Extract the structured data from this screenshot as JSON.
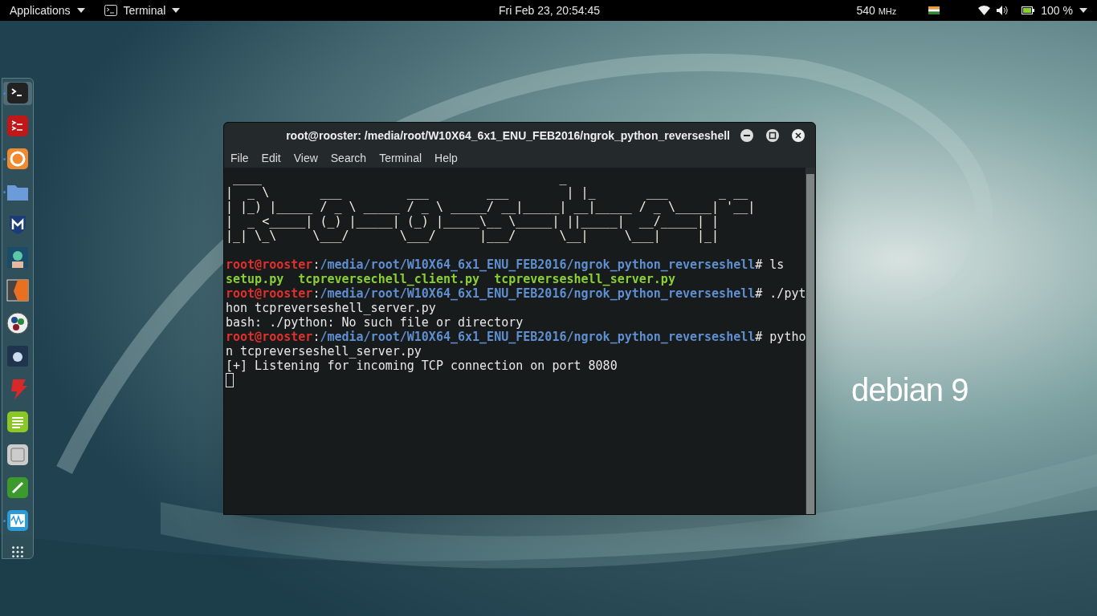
{
  "top_bar": {
    "applications_menu": "Applications",
    "app_menu": "Terminal",
    "clock": "Fri Feb 23, 20:54:45",
    "cpu_freq": "540",
    "cpu_unit": "MHz",
    "battery": "100 %"
  },
  "dock": {
    "items": [
      {
        "selected": true,
        "running": true
      },
      {
        "selected": false,
        "running": false
      },
      {
        "selected": false,
        "running": true
      },
      {
        "selected": false,
        "running": true
      },
      {
        "selected": false,
        "running": false
      },
      {
        "selected": false,
        "running": false
      },
      {
        "selected": false,
        "running": false
      },
      {
        "selected": false,
        "running": false
      },
      {
        "selected": false,
        "running": false
      },
      {
        "selected": false,
        "running": false
      },
      {
        "selected": false,
        "running": false
      },
      {
        "selected": false,
        "running": false
      },
      {
        "selected": false,
        "running": false
      },
      {
        "selected": false,
        "running": true
      }
    ]
  },
  "desktop": {
    "logo_text": "debian 9"
  },
  "window": {
    "title": "root@rooster: /media/root/W10X64_6x1_ENU_FEB2016/ngrok_python_reverseshell",
    "menu": [
      "File",
      "Edit",
      "View",
      "Search",
      "Terminal",
      "Help"
    ],
    "banner": [
      " ____                                         _",
      "|  _ \\       ___         ___        ___        | |_       ___       _ __",
      "| |_) |_____ / _ \\ _____ / _ \\ _____/ __|_____| __|_____ / _ \\_____| '__|",
      "|  _ <_____| (_) |_____| (_) |_____\\__ \\_____| ||_____|  __/_____| |",
      "|_| \\_\\     \\___/       \\___/      |___/      \\__|     \\___|     |_|"
    ],
    "lines": [
      [
        {
          "kind": "user",
          "text": "root@rooster"
        },
        {
          "kind": "plain",
          "text": ":"
        },
        {
          "kind": "path",
          "text": "/media/root/W10X64_6x1_ENU_FEB2016/ngrok_python_reverseshell"
        },
        {
          "kind": "plain",
          "text": "# ls"
        }
      ],
      [
        {
          "kind": "file",
          "text": "setup.py  tcpreversechell_client.py  tcpreverseshell_server.py"
        }
      ],
      [
        {
          "kind": "user",
          "text": "root@rooster"
        },
        {
          "kind": "plain",
          "text": ":"
        },
        {
          "kind": "path",
          "text": "/media/root/W10X64_6x1_ENU_FEB2016/ngrok_python_reverseshell"
        },
        {
          "kind": "plain",
          "text": "# ./pyt"
        }
      ],
      [
        {
          "kind": "plain",
          "text": "hon tcpreverseshell_server.py"
        }
      ],
      [
        {
          "kind": "plain",
          "text": "bash: ./python: No such file or directory"
        }
      ],
      [
        {
          "kind": "user",
          "text": "root@rooster"
        },
        {
          "kind": "plain",
          "text": ":"
        },
        {
          "kind": "path",
          "text": "/media/root/W10X64_6x1_ENU_FEB2016/ngrok_python_reverseshell"
        },
        {
          "kind": "plain",
          "text": "# pytho"
        }
      ],
      [
        {
          "kind": "plain",
          "text": "n tcpreverseshell_server.py"
        }
      ],
      [
        {
          "kind": "plain",
          "text": "[+] Listening for incoming TCP connection on port 8080"
        }
      ]
    ]
  }
}
